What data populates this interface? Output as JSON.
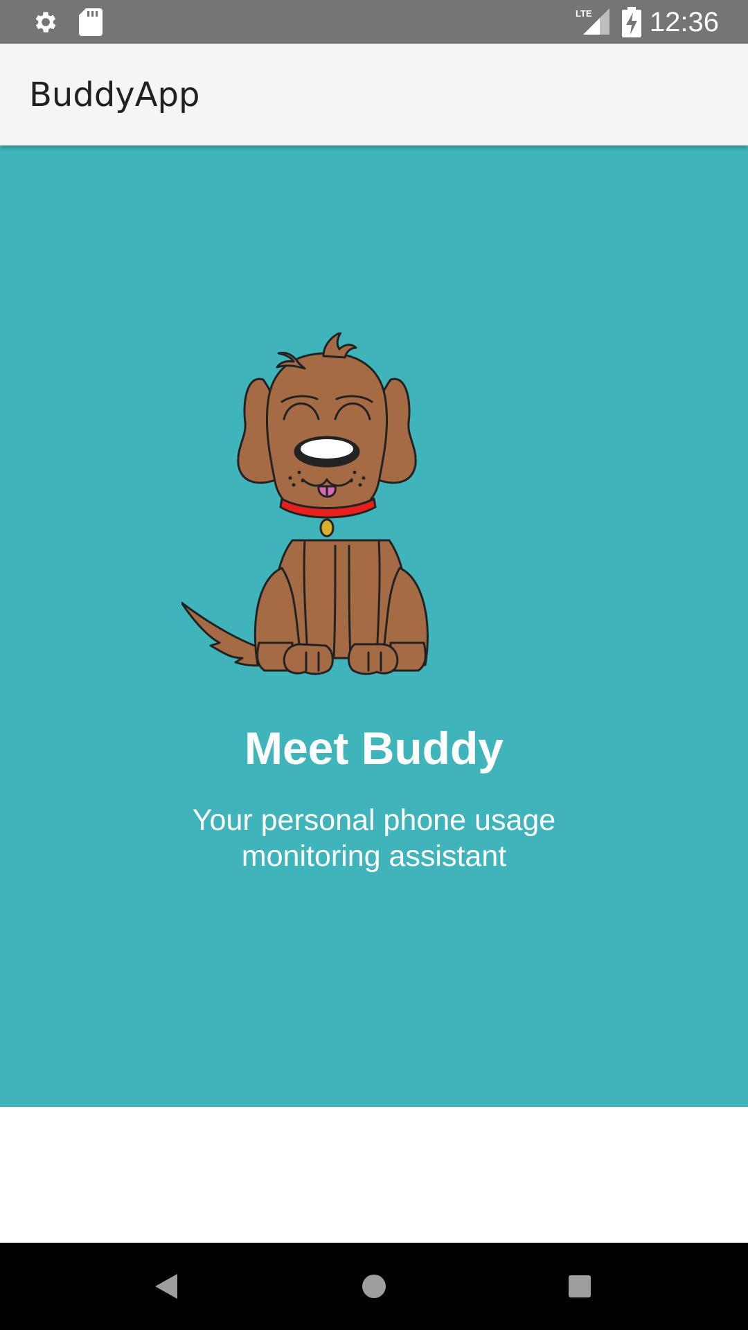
{
  "status_bar": {
    "time": "12:36",
    "lte_label": "LTE",
    "icons": [
      "settings-icon",
      "sd-card-icon",
      "lte-signal-icon",
      "battery-charging-icon"
    ]
  },
  "app_bar": {
    "title": "BuddyApp"
  },
  "hero": {
    "title": "Meet Buddy",
    "subtitle": "Your personal phone usage monitoring assistant",
    "image": "dog-illustration",
    "background_color": "#40b4bb"
  },
  "nav_bar": {
    "buttons": [
      "back-icon",
      "home-icon",
      "recents-icon"
    ]
  },
  "colors": {
    "status_bar": "#757575",
    "app_bar": "#f5f5f5",
    "accent": "#40b4bb",
    "dog_fur": "#a56b44",
    "collar": "#e8201c"
  }
}
